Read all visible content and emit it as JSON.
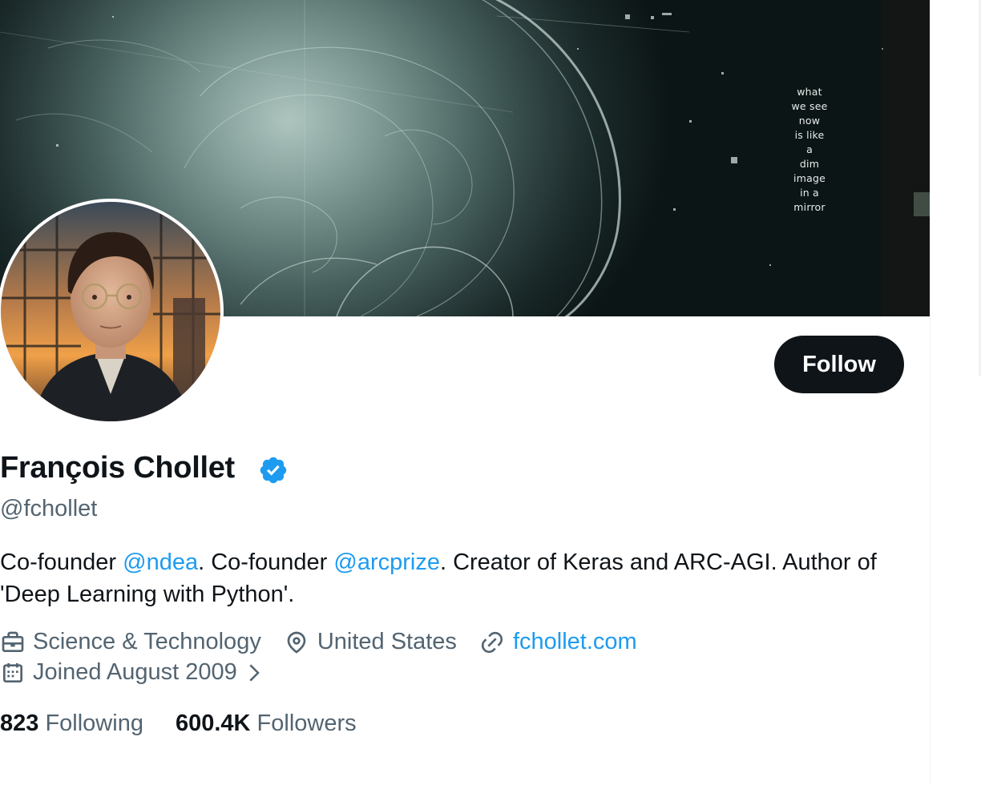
{
  "profile": {
    "name": "François Chollet",
    "handle": "@fchollet",
    "verified": true,
    "follow_label": "Follow",
    "bio": {
      "text1": "Co-founder ",
      "mention1": "@ndea",
      "text2": ". Co-founder ",
      "mention2": "@arcprize",
      "text3": ". Creator of Keras and ARC-AGI. Author of 'Deep Learning with Python'."
    },
    "category": "Science & Technology",
    "location": "United States",
    "website": "fchollet.com",
    "joined": "Joined August 2009",
    "following_count": "823",
    "following_label": "Following",
    "followers_count": "600.4K",
    "followers_label": "Followers"
  },
  "banner": {
    "poem_lines": [
      "what",
      "we see",
      "now",
      "is like",
      "a",
      "dim",
      "image",
      "in a",
      "mirror"
    ]
  },
  "icons": {
    "verified": "verified-badge-icon",
    "category": "briefcase-icon",
    "location": "location-pin-icon",
    "website": "link-icon",
    "joined": "calendar-icon",
    "joined_more": "chevron-right-icon"
  },
  "colors": {
    "accent": "#1d9bf0",
    "text": "#0f1419",
    "secondary_text": "#536471",
    "button_bg": "#0f1419"
  }
}
